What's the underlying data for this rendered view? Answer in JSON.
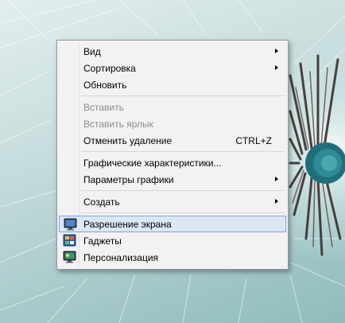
{
  "desktop": {
    "wallpaper": "dandelion"
  },
  "context_menu": {
    "items": [
      {
        "label": "Вид",
        "submenu": true
      },
      {
        "label": "Сортировка",
        "submenu": true
      },
      {
        "label": "Обновить"
      },
      {
        "label": "Вставить",
        "disabled": true
      },
      {
        "label": "Вставить ярлык",
        "disabled": true
      },
      {
        "label": "Отменить удаление",
        "shortcut": "CTRL+Z"
      },
      {
        "label": "Графические характеристики..."
      },
      {
        "label": "Параметры графики",
        "submenu": true
      },
      {
        "label": "Создать",
        "submenu": true
      },
      {
        "label": "Разрешение экрана",
        "icon": "display-icon",
        "selected": true
      },
      {
        "label": "Гаджеты",
        "icon": "gadgets-icon"
      },
      {
        "label": "Персонализация",
        "icon": "personalization-icon"
      }
    ]
  },
  "colors": {
    "menu_background": "#f2f2f2",
    "selection_background": "#dbe7f5",
    "selection_border": "#7fa6d6",
    "disabled_text": "#8d8d8d"
  }
}
